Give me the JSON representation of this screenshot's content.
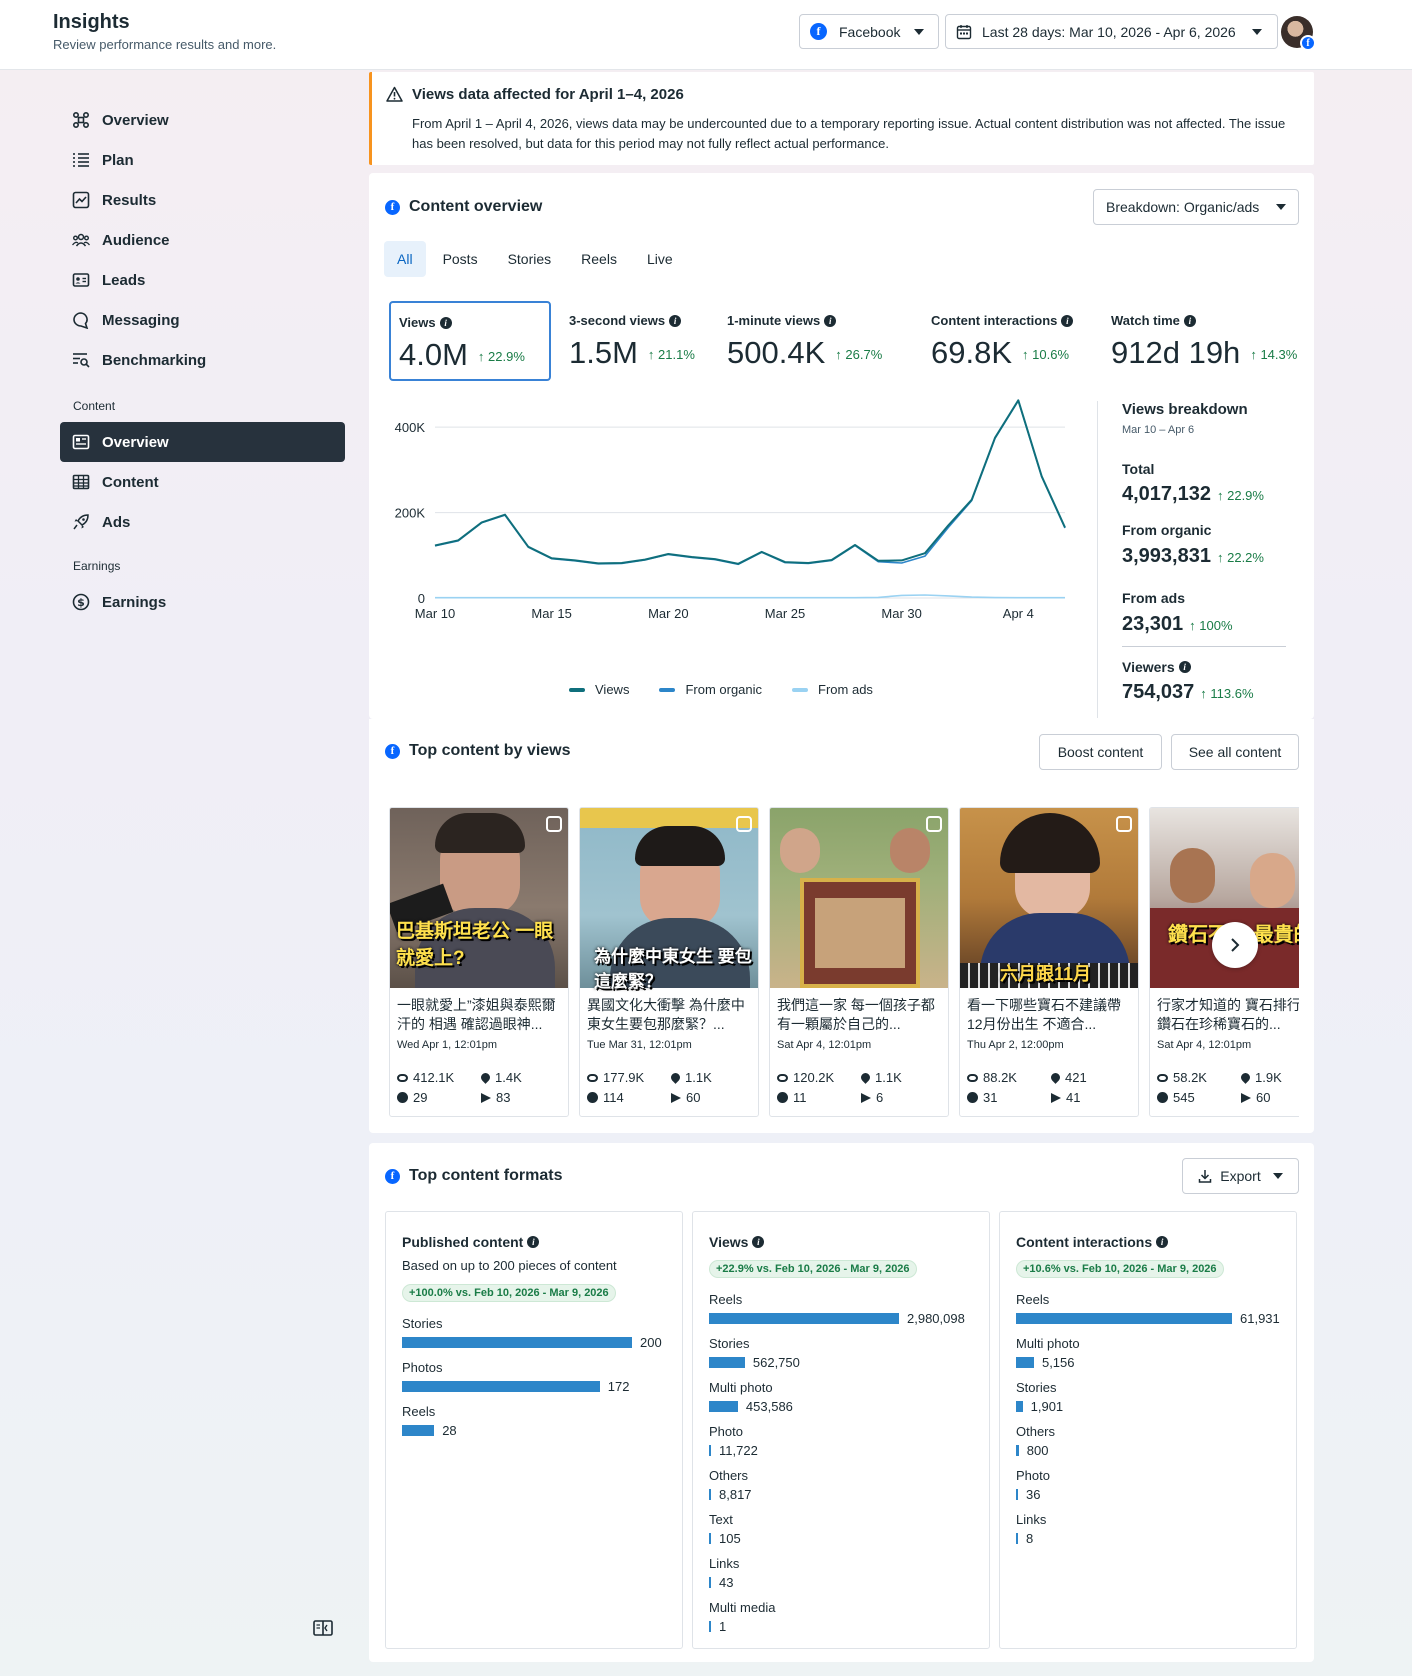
{
  "header": {
    "title": "Insights",
    "subtitle": "Review performance results and more.",
    "platform": "Facebook",
    "date_range": "Last 28 days: Mar 10, 2026 - Apr 6, 2026"
  },
  "sidebar": {
    "items": [
      {
        "label": "Overview",
        "icon": "overview-icon"
      },
      {
        "label": "Plan",
        "icon": "plan-icon"
      },
      {
        "label": "Results",
        "icon": "results-icon"
      },
      {
        "label": "Audience",
        "icon": "audience-icon"
      },
      {
        "label": "Leads",
        "icon": "leads-icon"
      },
      {
        "label": "Messaging",
        "icon": "messaging-icon"
      },
      {
        "label": "Benchmarking",
        "icon": "benchmarking-icon"
      }
    ],
    "content_section": "Content",
    "content_items": [
      {
        "label": "Overview",
        "icon": "content-overview-icon",
        "active": true
      },
      {
        "label": "Content",
        "icon": "table-icon"
      },
      {
        "label": "Ads",
        "icon": "rocket-icon"
      }
    ],
    "earnings_section": "Earnings",
    "earnings_items": [
      {
        "label": "Earnings",
        "icon": "dollar-icon"
      }
    ]
  },
  "notice": {
    "title": "Views data affected for April 1–4, 2026",
    "body": "From April 1 – April 4, 2026, views data may be undercounted due to a temporary reporting issue. Actual content distribution was not affected. The issue has been resolved, but data for this period may not fully reflect actual performance."
  },
  "content_overview": {
    "title": "Content overview",
    "breakdown_button": "Breakdown: Organic/ads",
    "tabs": [
      "All",
      "Posts",
      "Stories",
      "Reels",
      "Live"
    ],
    "metrics": [
      {
        "label": "Views",
        "value": "4.0M",
        "change": "22.9%"
      },
      {
        "label": "3-second views",
        "value": "1.5M",
        "change": "21.1%"
      },
      {
        "label": "1-minute views",
        "value": "500.4K",
        "change": "26.7%"
      },
      {
        "label": "Content interactions",
        "value": "69.8K",
        "change": "10.6%"
      },
      {
        "label": "Watch time",
        "value": "912d 19h",
        "change": "14.3%"
      }
    ],
    "breakdown": {
      "title": "Views breakdown",
      "range": "Mar 10 – Apr 6",
      "total_label": "Total",
      "total": "4,017,132",
      "total_change": "22.9%",
      "organic_label": "From organic",
      "organic": "3,993,831",
      "organic_change": "22.2%",
      "ads_label": "From ads",
      "ads": "23,301",
      "ads_change": "100%",
      "viewers_label": "Viewers",
      "viewers": "754,037",
      "viewers_change": "113.6%"
    }
  },
  "chart_data": {
    "type": "line",
    "x": [
      "Mar 10",
      "Mar 11",
      "Mar 12",
      "Mar 13",
      "Mar 14",
      "Mar 15",
      "Mar 16",
      "Mar 17",
      "Mar 18",
      "Mar 19",
      "Mar 20",
      "Mar 21",
      "Mar 22",
      "Mar 23",
      "Mar 24",
      "Mar 25",
      "Mar 26",
      "Mar 27",
      "Mar 28",
      "Mar 29",
      "Mar 30",
      "Mar 31",
      "Apr 1",
      "Apr 2",
      "Apr 3",
      "Apr 4",
      "Apr 5",
      "Apr 6"
    ],
    "x_ticks": [
      "Mar 10",
      "Mar 15",
      "Mar 20",
      "Mar 25",
      "Mar 30",
      "Apr 4"
    ],
    "y_ticks": [
      "0",
      "200K",
      "400K"
    ],
    "ylim": [
      0,
      480000
    ],
    "series": [
      {
        "name": "Views",
        "color": "#0f6f7c",
        "values": [
          123000,
          135000,
          177000,
          195000,
          120000,
          93000,
          88000,
          81000,
          82000,
          90000,
          103000,
          96000,
          91000,
          80000,
          108000,
          84000,
          82000,
          89000,
          124000,
          87000,
          88000,
          105000,
          170000,
          230000,
          375000,
          463000,
          285000,
          165000
        ]
      },
      {
        "name": "From organic",
        "color": "#2d86c9",
        "values": [
          122000,
          134000,
          176000,
          194000,
          119000,
          92000,
          87000,
          80000,
          81000,
          89000,
          102000,
          95000,
          90000,
          79000,
          107000,
          83000,
          81000,
          88000,
          123000,
          85000,
          82000,
          98000,
          165000,
          228000,
          374000,
          462000,
          284000,
          164000
        ]
      },
      {
        "name": "From ads",
        "color": "#9ad2f2",
        "values": [
          600,
          600,
          600,
          600,
          600,
          600,
          600,
          600,
          600,
          600,
          600,
          600,
          600,
          600,
          600,
          600,
          600,
          600,
          600,
          1500,
          6000,
          7000,
          5000,
          2000,
          1000,
          800,
          700,
          600
        ]
      }
    ]
  },
  "top_content": {
    "title": "Top content by views",
    "boost_button": "Boost content",
    "see_all_button": "See all content",
    "items": [
      {
        "caption": "一眼就愛上”漆姐與泰熙爾汗的 相遇 確認過眼神...",
        "date": "Wed Apr 1, 12:01pm",
        "views": "412.1K",
        "likes": "1.4K",
        "comments": "29",
        "shares": "83",
        "overlay": "巴基斯坦老公 一眼就愛上?"
      },
      {
        "caption": "異國文化大衝擊 為什麼中東女生要包那麼緊？...",
        "date": "Tue Mar 31, 12:01pm",
        "views": "177.9K",
        "likes": "1.1K",
        "comments": "114",
        "shares": "60",
        "overlay": "為什麼中東女生 要包這麼緊？"
      },
      {
        "caption": "我們這一家 每一個孩子都有一顆屬於自己的...",
        "date": "Sat Apr 4, 12:01pm",
        "views": "120.2K",
        "likes": "1.1K",
        "comments": "11",
        "shares": "6",
        "overlay": ""
      },
      {
        "caption": "看一下哪些寶石不建議帶 12月份出生 不適合...",
        "date": "Thu Apr 2, 12:00pm",
        "views": "88.2K",
        "likes": "421",
        "comments": "31",
        "shares": "41",
        "overlay": "六月跟11月"
      },
      {
        "caption": "行家才知道的 寶石排行榜 鑽石在珍稀寶石的...",
        "date": "Sat Apr 4, 12:01pm",
        "views": "58.2K",
        "likes": "1.9K",
        "comments": "545",
        "shares": "60",
        "overlay": "鑽石不是 最貴的"
      }
    ]
  },
  "formats": {
    "title": "Top content formats",
    "export_button": "Export",
    "published": {
      "title": "Published content",
      "subtitle": "Based on up to 200 pieces of content",
      "pill": "+100.0% vs. Feb 10, 2026 - Mar 9, 2026",
      "max": 200,
      "rows": [
        {
          "label": "Stories",
          "value": 200,
          "display": "200"
        },
        {
          "label": "Photos",
          "value": 172,
          "display": "172"
        },
        {
          "label": "Reels",
          "value": 28,
          "display": "28"
        }
      ]
    },
    "views": {
      "title": "Views",
      "pill": "+22.9% vs. Feb 10, 2026 - Mar 9, 2026",
      "max": 2980098,
      "rows": [
        {
          "label": "Reels",
          "value": 2980098,
          "display": "2,980,098"
        },
        {
          "label": "Stories",
          "value": 562750,
          "display": "562,750"
        },
        {
          "label": "Multi photo",
          "value": 453586,
          "display": "453,586"
        },
        {
          "label": "Photo",
          "value": 11722,
          "display": "11,722"
        },
        {
          "label": "Others",
          "value": 8817,
          "display": "8,817"
        },
        {
          "label": "Text",
          "value": 105,
          "display": "105"
        },
        {
          "label": "Links",
          "value": 43,
          "display": "43"
        },
        {
          "label": "Multi media",
          "value": 1,
          "display": "1"
        }
      ]
    },
    "interactions": {
      "title": "Content interactions",
      "pill": "+10.6% vs. Feb 10, 2026 - Mar 9, 2026",
      "max": 61931,
      "rows": [
        {
          "label": "Reels",
          "value": 61931,
          "display": "61,931"
        },
        {
          "label": "Multi photo",
          "value": 5156,
          "display": "5,156"
        },
        {
          "label": "Stories",
          "value": 1901,
          "display": "1,901"
        },
        {
          "label": "Others",
          "value": 800,
          "display": "800"
        },
        {
          "label": "Photo",
          "value": 36,
          "display": "36"
        },
        {
          "label": "Links",
          "value": 8,
          "display": "8"
        }
      ]
    }
  }
}
